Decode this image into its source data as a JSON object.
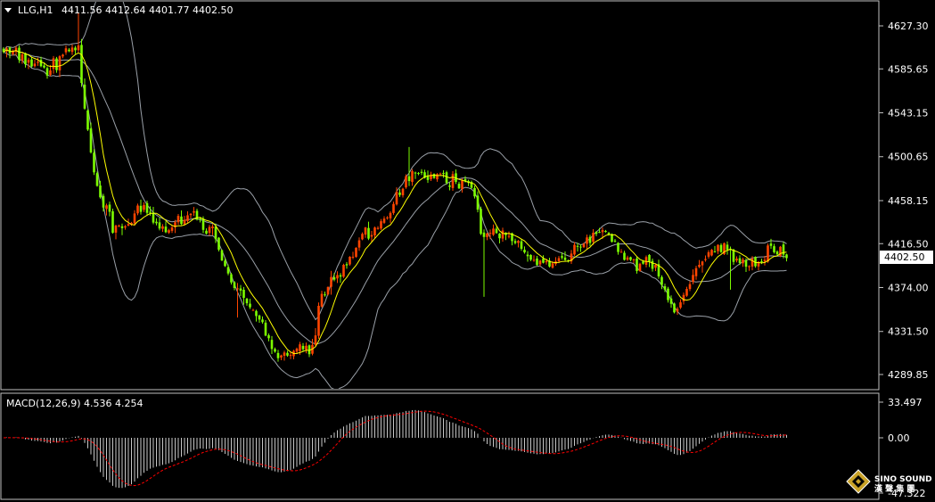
{
  "header": {
    "symbol": "LLG,H1",
    "ohlc": "4411.56 4412.64 4401.77 4402.50"
  },
  "main_axis": {
    "ticks": [
      "4627.30",
      "4585.65",
      "4543.15",
      "4500.65",
      "4458.15",
      "4416.50",
      "4374.00",
      "4331.50",
      "4289.85"
    ],
    "current_price": "4402.50"
  },
  "macd": {
    "label": "MACD(12,26,9) 4.536 4.254",
    "ticks": [
      "33.497",
      "0.00",
      "-47.322"
    ]
  },
  "logo": {
    "line1": "SINO SOUND",
    "line2": "漢 聲 集 團"
  },
  "colors": {
    "background": "#000000",
    "bull": "#ff4500",
    "bear": "#7cfc00",
    "bands": "#9aa0a8",
    "ma": "#ffff00",
    "macd_hist": "#c8c8c8",
    "macd_signal": "#ff0000",
    "border": "#c0c0c0"
  },
  "chart_data": [
    {
      "type": "candlestick",
      "title": "LLG,H1",
      "ylim": [
        4280,
        4645
      ],
      "ticks": [
        4627.3,
        4585.65,
        4543.15,
        4500.65,
        4458.15,
        4416.5,
        4374.0,
        4331.5,
        4289.85
      ],
      "last": 4402.5,
      "close_path": [
        [
          0,
          4605
        ],
        [
          20,
          4598
        ],
        [
          40,
          4590
        ],
        [
          55,
          4583
        ],
        [
          70,
          4600
        ],
        [
          82,
          4608
        ],
        [
          88,
          4600
        ],
        [
          95,
          4545
        ],
        [
          105,
          4485
        ],
        [
          115,
          4455
        ],
        [
          125,
          4440
        ],
        [
          135,
          4430
        ],
        [
          145,
          4440
        ],
        [
          155,
          4448
        ],
        [
          165,
          4445
        ],
        [
          175,
          4433
        ],
        [
          185,
          4430
        ],
        [
          195,
          4435
        ],
        [
          205,
          4440
        ],
        [
          215,
          4443
        ],
        [
          225,
          4438
        ],
        [
          235,
          4430
        ],
        [
          245,
          4418
        ],
        [
          255,
          4388
        ],
        [
          265,
          4370
        ],
        [
          275,
          4360
        ],
        [
          285,
          4350
        ],
        [
          295,
          4337
        ],
        [
          305,
          4320
        ],
        [
          315,
          4305
        ],
        [
          325,
          4308
        ],
        [
          335,
          4315
        ],
        [
          345,
          4312
        ],
        [
          352,
          4320
        ],
        [
          358,
          4355
        ],
        [
          365,
          4375
        ],
        [
          375,
          4383
        ],
        [
          385,
          4390
        ],
        [
          395,
          4405
        ],
        [
          405,
          4425
        ],
        [
          415,
          4430
        ],
        [
          425,
          4430
        ],
        [
          435,
          4440
        ],
        [
          445,
          4462
        ],
        [
          455,
          4480
        ],
        [
          465,
          4488
        ],
        [
          475,
          4485
        ],
        [
          485,
          4480
        ],
        [
          495,
          4483
        ],
        [
          505,
          4478
        ],
        [
          515,
          4476
        ],
        [
          525,
          4475
        ],
        [
          532,
          4470
        ],
        [
          540,
          4425
        ],
        [
          548,
          4425
        ],
        [
          555,
          4430
        ],
        [
          565,
          4425
        ],
        [
          575,
          4420
        ],
        [
          585,
          4410
        ],
        [
          595,
          4402
        ],
        [
          605,
          4400
        ],
        [
          615,
          4396
        ],
        [
          625,
          4395
        ],
        [
          635,
          4405
        ],
        [
          645,
          4410
        ],
        [
          655,
          4415
        ],
        [
          665,
          4425
        ],
        [
          675,
          4430
        ],
        [
          685,
          4425
        ],
        [
          695,
          4405
        ],
        [
          705,
          4398
        ],
        [
          715,
          4397
        ],
        [
          725,
          4400
        ],
        [
          735,
          4392
        ],
        [
          745,
          4370
        ],
        [
          755,
          4355
        ],
        [
          762,
          4355
        ],
        [
          772,
          4375
        ],
        [
          782,
          4395
        ],
        [
          792,
          4405
        ],
        [
          802,
          4408
        ],
        [
          812,
          4412
        ],
        [
          822,
          4405
        ],
        [
          832,
          4402
        ],
        [
          842,
          4398
        ],
        [
          852,
          4400
        ],
        [
          862,
          4408
        ],
        [
          872,
          4412
        ],
        [
          878,
          4410
        ],
        [
          884,
          4402.5
        ]
      ]
    },
    {
      "type": "bar",
      "title": "MACD(12,26,9) 4.536 4.254",
      "ylim": [
        -47.322,
        33.497
      ],
      "ticks": [
        33.497,
        0.0,
        -47.322
      ],
      "macd": 4.536,
      "signal": 4.254
    }
  ]
}
